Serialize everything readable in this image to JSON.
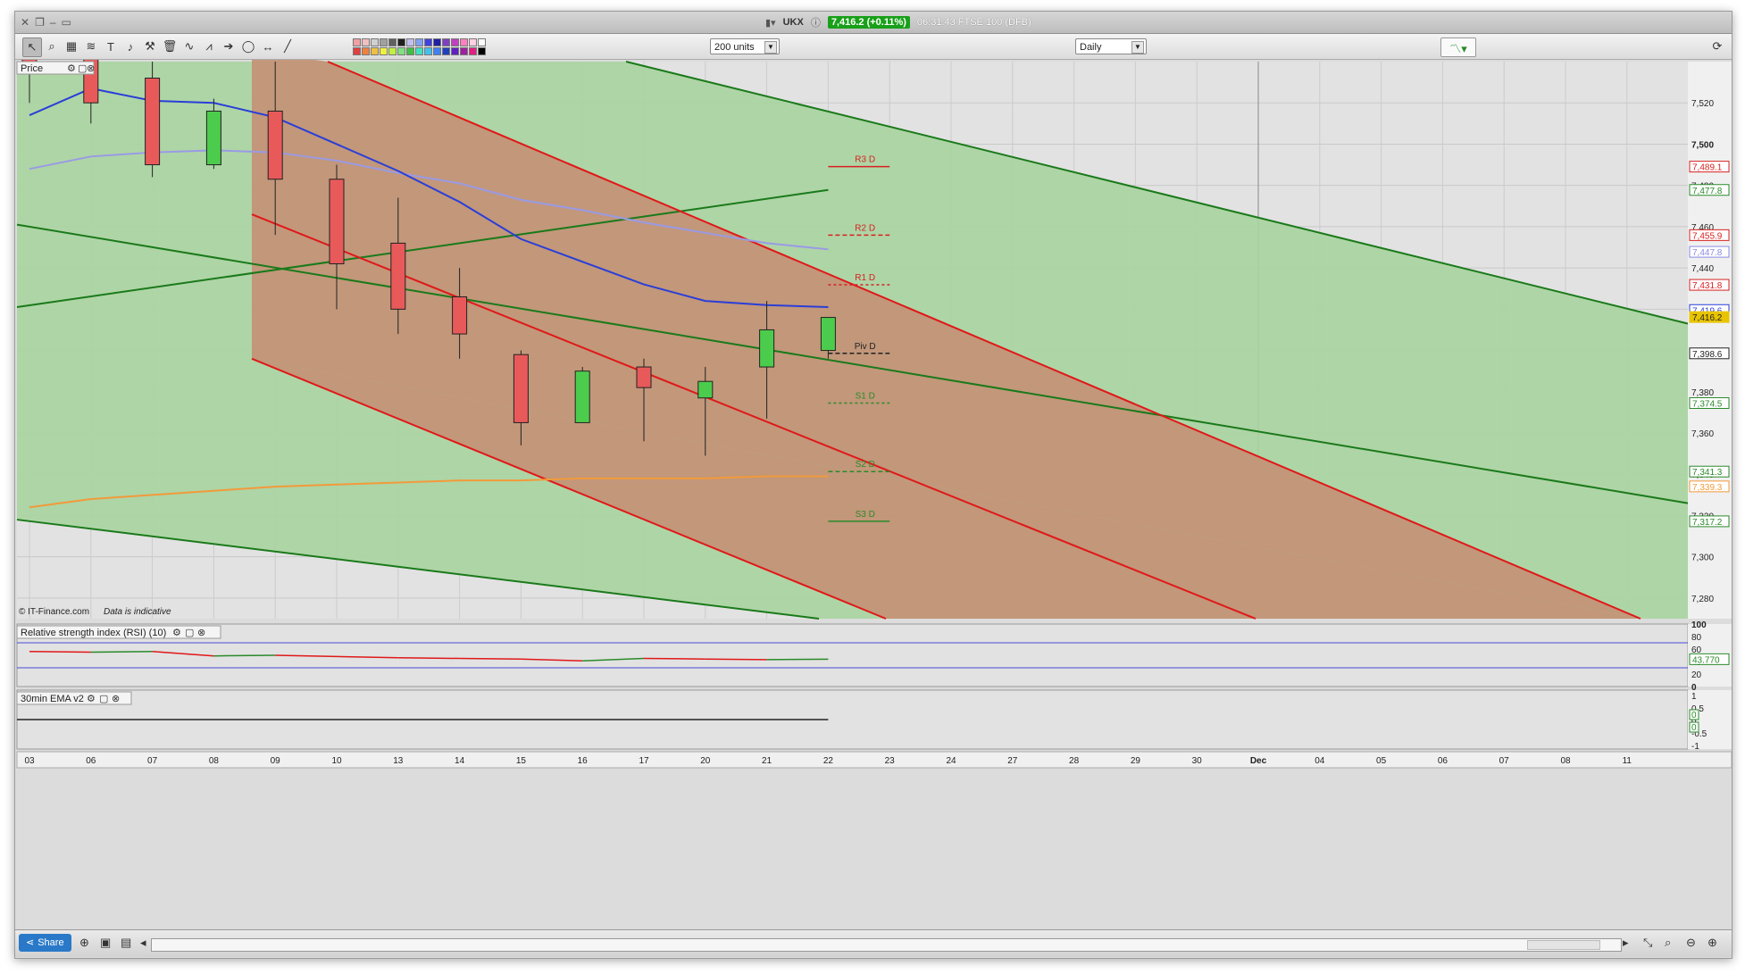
{
  "window": {
    "titlebar": {
      "symbol": "UKX",
      "price_badge": "7,416.2 (+0.11%)",
      "time_and_name": "06:31:43 FTSE 100 (DFB)"
    }
  },
  "toolbar": {
    "units_select": "200 units",
    "interval_select": "Daily"
  },
  "panels": {
    "price": {
      "label": "Price",
      "watermark_company": "© IT-Finance.com",
      "watermark_note": "Data is indicative"
    },
    "rsi": {
      "label": "Relative strength index (RSI) (10)"
    },
    "ema": {
      "label": "30min EMA v2"
    }
  },
  "price_axis": {
    "ticks": [
      "7,520",
      "7,500",
      "7,480",
      "7,460",
      "7,440",
      "7,420",
      "7,400",
      "7,380",
      "7,360",
      "7,340",
      "7,320",
      "7,300",
      "7,280"
    ],
    "tags": [
      {
        "text": "7,489.1",
        "color": "#d82020"
      },
      {
        "text": "7,477.8",
        "color": "#2a8a2a"
      },
      {
        "text": "7,455.9",
        "color": "#d82020"
      },
      {
        "text": "7,447.8",
        "color": "#8a8ae6"
      },
      {
        "text": "7,431.8",
        "color": "#d82020"
      },
      {
        "text": "7,419.6",
        "color": "#2a3ed8"
      },
      {
        "text": "7,416.2",
        "color": "#e8c400"
      },
      {
        "text": "7,398.6",
        "color": "#222222"
      },
      {
        "text": "7,374.5",
        "color": "#2a8a2a"
      },
      {
        "text": "7,341.3",
        "color": "#2a8a2a"
      },
      {
        "text": "7,339.3",
        "color": "#f29a3a"
      },
      {
        "text": "7,317.2",
        "color": "#2a8a2a"
      }
    ]
  },
  "pivot_labels": [
    {
      "text": "R3 D",
      "color": "#d82020"
    },
    {
      "text": "R2 D",
      "color": "#d82020"
    },
    {
      "text": "R1 D",
      "color": "#d82020"
    },
    {
      "text": "Piv D",
      "color": "#222222"
    },
    {
      "text": "S1 D",
      "color": "#2a8a2a"
    },
    {
      "text": "S2 D",
      "color": "#2a8a2a"
    },
    {
      "text": "S3 D",
      "color": "#2a8a2a"
    }
  ],
  "rsi_axis": {
    "ticks": [
      "100",
      "80",
      "60",
      "40",
      "20",
      "0"
    ],
    "value_tag": "43.770"
  },
  "ema_axis": {
    "ticks": [
      "1",
      "0.5",
      "0",
      "-0.5",
      "-1"
    ],
    "value_tags": [
      "0",
      "0"
    ]
  },
  "x_axis": {
    "labels": [
      "03",
      "06",
      "07",
      "08",
      "09",
      "10",
      "13",
      "14",
      "15",
      "16",
      "17",
      "20",
      "21",
      "22",
      "23",
      "24",
      "27",
      "28",
      "29",
      "30",
      "Dec",
      "04",
      "05",
      "06",
      "07",
      "08",
      "11"
    ]
  },
  "bottombar": {
    "share_label": "Share"
  },
  "colors": {
    "green_channel": "#a9d4a0",
    "red_channel": "#c39377",
    "bull_candle": "#4ccc4c",
    "bear_candle": "#e85a5a",
    "ma_fast": "#2a3ed8",
    "ma_slow": "#9a9ae6",
    "ma_long": "#f29a3a"
  },
  "chart_data": {
    "type": "candlestick",
    "dates": [
      "03",
      "06",
      "07",
      "08",
      "09",
      "10",
      "13",
      "14",
      "15",
      "16",
      "17",
      "20",
      "21",
      "22"
    ],
    "ohlc": [
      [
        7560,
        7580,
        7520,
        7540
      ],
      [
        7545,
        7550,
        7510,
        7520
      ],
      [
        7532,
        7540,
        7484,
        7490
      ],
      [
        7490,
        7522,
        7488,
        7516
      ],
      [
        7516,
        7540,
        7456,
        7483
      ],
      [
        7483,
        7490,
        7420,
        7442
      ],
      [
        7452,
        7474,
        7408,
        7420
      ],
      [
        7426,
        7440,
        7396,
        7408
      ],
      [
        7398,
        7400,
        7354,
        7365
      ],
      [
        7365,
        7392,
        7365,
        7390
      ],
      [
        7392,
        7396,
        7356,
        7382
      ],
      [
        7377,
        7392,
        7349,
        7385
      ],
      [
        7392,
        7424,
        7367,
        7410
      ],
      [
        7400,
        7412,
        7396,
        7416
      ]
    ],
    "ma_fast": [
      7514,
      7527,
      7521,
      7520,
      7513,
      7500,
      7487,
      7472,
      7454,
      7443,
      7432,
      7424,
      7422,
      7421
    ],
    "ma_slow": [
      7488,
      7494,
      7496,
      7497,
      7496,
      7492,
      7486,
      7481,
      7473,
      7468,
      7462,
      7457,
      7452,
      7449
    ],
    "ma_long": [
      7324,
      7328,
      7330,
      7332,
      7334,
      7335,
      7336,
      7337,
      7337,
      7338,
      7338,
      7338,
      7339,
      7339
    ],
    "pivots": {
      "R3": 7489.1,
      "R2": 7455.9,
      "R1": 7431.8,
      "Piv": 7398.6,
      "S1": 7374.5,
      "S2": 7341.3,
      "S3": 7317.2
    },
    "last_price": 7416.2,
    "rsi": [
      56,
      55,
      56,
      49,
      50,
      48,
      46,
      45,
      44,
      41,
      45,
      44,
      43,
      43.77
    ],
    "ylim": [
      7270,
      7540
    ]
  }
}
